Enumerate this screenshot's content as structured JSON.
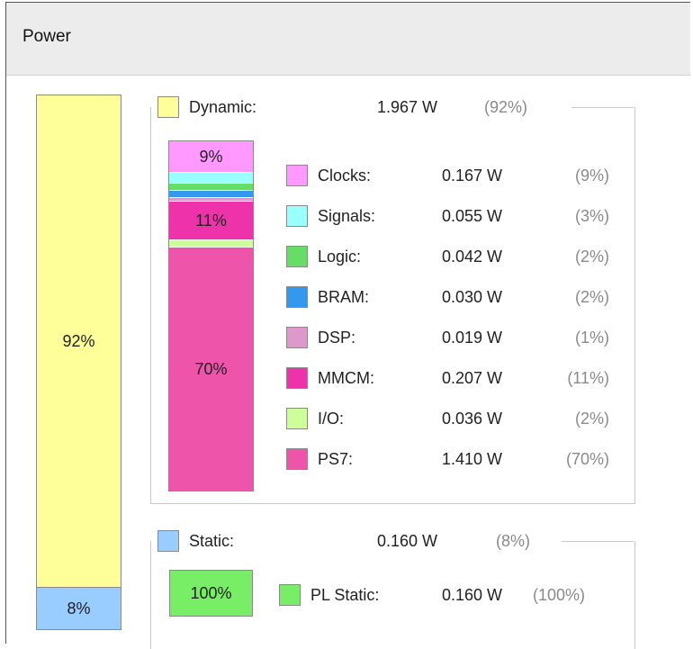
{
  "header": {
    "title": "Power"
  },
  "total_bar": {
    "dynamic": {
      "label": "92%",
      "value": 0.92,
      "color": "#ffff99"
    },
    "static": {
      "label": "8%",
      "value": 0.08,
      "color": "#99ccff"
    }
  },
  "dynamic": {
    "label": "Dynamic:",
    "watts": "1.967 W",
    "percent": "(92%)",
    "color": "#ffff99",
    "stack": [
      {
        "name": "Clocks",
        "value": 0.09,
        "label": "9%",
        "color": "#ff99ff"
      },
      {
        "name": "Signals",
        "value": 0.03,
        "label": "",
        "color": "#99ffff"
      },
      {
        "name": "Logic",
        "value": 0.02,
        "label": "",
        "color": "#66dd66"
      },
      {
        "name": "BRAM",
        "value": 0.02,
        "label": "",
        "color": "#3399ee"
      },
      {
        "name": "DSP",
        "value": 0.01,
        "label": "",
        "color": "#dd99cc"
      },
      {
        "name": "MMCM",
        "value": 0.11,
        "label": "11%",
        "color": "#ee33aa"
      },
      {
        "name": "I/O",
        "value": 0.02,
        "label": "",
        "color": "#ccff99"
      },
      {
        "name": "PS7",
        "value": 0.7,
        "label": "70%",
        "color": "#ee55aa"
      }
    ],
    "items": [
      {
        "label": "Clocks:",
        "watts": "0.167 W",
        "percent": "(9%)",
        "color": "#ff99ff"
      },
      {
        "label": "Signals:",
        "watts": "0.055 W",
        "percent": "(3%)",
        "color": "#99ffff"
      },
      {
        "label": "Logic:",
        "watts": "0.042 W",
        "percent": "(2%)",
        "color": "#66dd66"
      },
      {
        "label": "BRAM:",
        "watts": "0.030 W",
        "percent": "(2%)",
        "color": "#3399ee"
      },
      {
        "label": "DSP:",
        "watts": "0.019 W",
        "percent": "(1%)",
        "color": "#dd99cc"
      },
      {
        "label": "MMCM:",
        "watts": "0.207 W",
        "percent": "(11%)",
        "color": "#ee33aa"
      },
      {
        "label": "I/O:",
        "watts": "0.036 W",
        "percent": "(2%)",
        "color": "#ccff99"
      },
      {
        "label": "PS7:",
        "watts": "1.410 W",
        "percent": "(70%)",
        "color": "#ee55aa"
      }
    ]
  },
  "static": {
    "label": "Static:",
    "watts": "0.160 W",
    "percent": "(8%)",
    "color": "#99ccff",
    "bar": {
      "label": "100%",
      "value": 1.0,
      "color": "#77ee66"
    },
    "item": {
      "label": "PL Static:",
      "watts": "0.160 W",
      "percent": "(100%)",
      "color": "#77ee66"
    }
  }
}
